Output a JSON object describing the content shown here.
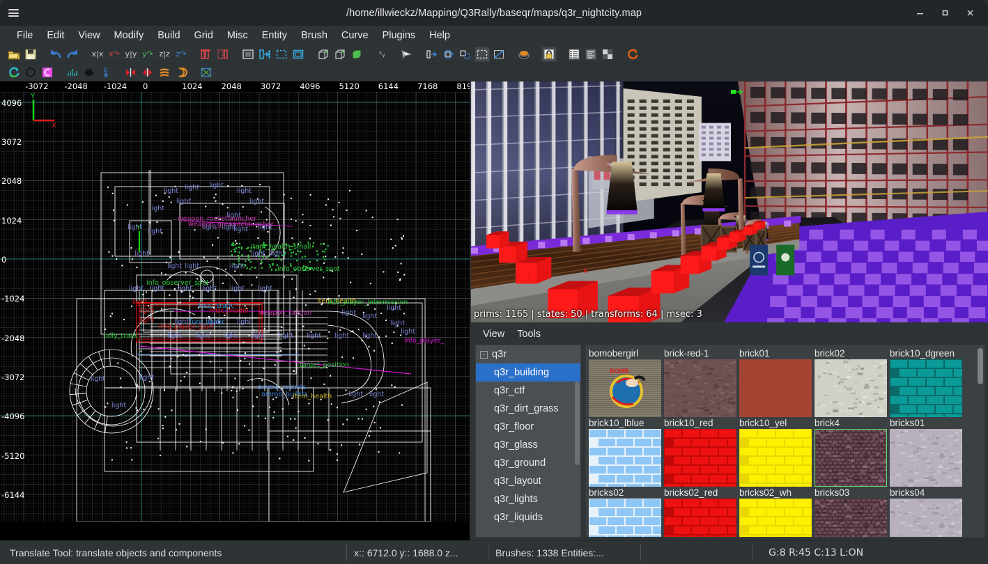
{
  "window": {
    "title": "/home/illwieckz/Mapping/Q3Rally/baseqr/maps/q3r_nightcity.map",
    "menu_icon": "hamburger-icon",
    "minimize_label": "–",
    "maximize_label": "□",
    "close_label": "✕"
  },
  "menubar": {
    "items": [
      {
        "label": "File"
      },
      {
        "label": "Edit"
      },
      {
        "label": "View"
      },
      {
        "label": "Modify"
      },
      {
        "label": "Build"
      },
      {
        "label": "Grid"
      },
      {
        "label": "Misc"
      },
      {
        "label": "Entity"
      },
      {
        "label": "Brush"
      },
      {
        "label": "Curve"
      },
      {
        "label": "Plugins"
      },
      {
        "label": "Help"
      }
    ]
  },
  "toolbar_main": {
    "items": [
      {
        "name": "open-map-icon",
        "kind": "folder",
        "color": "#e8c547"
      },
      {
        "name": "save-map-icon",
        "kind": "floppy",
        "color": "#dcd7a0"
      },
      {
        "name": "undo-icon",
        "kind": "arrow-undo",
        "color": "#3b7fd4"
      },
      {
        "name": "redo-icon",
        "kind": "arrow-redo",
        "color": "#3b7fd4"
      },
      {
        "name": "flip-x-icon",
        "kind": "text",
        "text": "x|x",
        "color": "#cfcfcf"
      },
      {
        "name": "rotate-x-icon",
        "kind": "text",
        "text": "x↷",
        "color": "#d04545"
      },
      {
        "name": "flip-y-icon",
        "kind": "text",
        "text": "y|y",
        "color": "#cfcfcf"
      },
      {
        "name": "rotate-y-icon",
        "kind": "text",
        "text": "y↷",
        "color": "#4fbd4f"
      },
      {
        "name": "flip-z-icon",
        "kind": "text",
        "text": "z|z",
        "color": "#cfcfcf"
      },
      {
        "name": "rotate-z-icon",
        "kind": "text",
        "text": "z↷",
        "color": "#3b7fd4"
      },
      {
        "name": "clipper-icon",
        "kind": "clip",
        "color": "#d64545"
      },
      {
        "name": "connect-entities-icon",
        "kind": "connect",
        "color": "#d64545"
      },
      {
        "name": "complete-tall-icon",
        "kind": "sel-box",
        "color": "#cfcfcf"
      },
      {
        "name": "select-touching-icon",
        "kind": "sel-touch",
        "color": "#37aee2"
      },
      {
        "name": "select-partial-icon",
        "kind": "sel-partial",
        "color": "#37aee2"
      },
      {
        "name": "select-inside-icon",
        "kind": "sel-inside",
        "color": "#37aee2"
      },
      {
        "name": "csg-subtract-icon",
        "kind": "cube",
        "color": "#4fbd4f"
      },
      {
        "name": "csg-merge-icon",
        "kind": "cube",
        "color": "#4fbd4f"
      },
      {
        "name": "csg-hollow-icon",
        "kind": "cube-filled",
        "color": "#4fbd4f"
      },
      {
        "name": "texture-lock-xy-icon",
        "kind": "text",
        "text": "ˣᵧ",
        "color": "#cfcfcf"
      },
      {
        "name": "camera-icon",
        "kind": "cone",
        "color": "#e8e8e8"
      },
      {
        "name": "translate-tool-icon",
        "kind": "translate",
        "color": "#3b7fd4"
      },
      {
        "name": "rotate-tool-icon",
        "kind": "rotate",
        "color": "#3b7fd4"
      },
      {
        "name": "scale-tool-icon",
        "kind": "scale",
        "color": "#3b7fd4"
      },
      {
        "name": "drag-tool-icon",
        "kind": "drag",
        "color": "#cfcfcf",
        "active": true
      },
      {
        "name": "resize-tool-icon",
        "kind": "resize",
        "color": "#3b7fd4"
      },
      {
        "name": "entity-inspector-icon",
        "kind": "ellipse",
        "color": "#e08a2a"
      },
      {
        "name": "texture-lock-icon",
        "kind": "lock",
        "color": "#e8c547",
        "active": true
      },
      {
        "name": "entity-list-icon",
        "kind": "list",
        "color": "#f0f0f0"
      },
      {
        "name": "console-icon",
        "kind": "lines",
        "color": "#9aa0a3"
      },
      {
        "name": "texture-window-icon",
        "kind": "checker",
        "color": "#9aa0a3"
      },
      {
        "name": "refresh-models-icon",
        "kind": "refresh",
        "color": "#e06010"
      }
    ]
  },
  "toolbar_plugins": {
    "items": [
      {
        "name": "bobtoolz-icon",
        "kind": "refresh2",
        "color": "#2bb3c9"
      },
      {
        "name": "prtview-icon",
        "kind": "hexagon",
        "color": "#2a2f31"
      },
      {
        "name": "gtkgensurf-icon",
        "kind": "gensurf",
        "color": "#e84ae8"
      },
      {
        "name": "brush-export-icon",
        "kind": "waves",
        "color": "#2f8f8f"
      },
      {
        "name": "model-icon",
        "kind": "blob",
        "color": "#1a1a1a"
      },
      {
        "name": "entity-export-icon",
        "kind": "eexport",
        "color": "#3b7fd4"
      },
      {
        "name": "mirror-left-icon",
        "kind": "mirror-l",
        "color": "#e02020"
      },
      {
        "name": "mirror-right-icon",
        "kind": "mirror-r",
        "color": "#e02020"
      },
      {
        "name": "bend-icon",
        "kind": "bend",
        "color": "#e08a2a"
      },
      {
        "name": "arc-icon",
        "kind": "arc",
        "color": "#e08a2a"
      },
      {
        "name": "sunplug-icon",
        "kind": "cross-box",
        "color": "#3b7fd4"
      }
    ]
  },
  "xy_view": {
    "x_ticks": [
      "-3072",
      "-2048",
      "-1024",
      "0",
      "1024",
      "2048",
      "3072",
      "4096",
      "5120",
      "6144",
      "7168",
      "819"
    ],
    "y_ticks": [
      "4096",
      "3072",
      "2048",
      "1024",
      "0",
      "-1024",
      "-2048",
      "-3072",
      "-4096",
      "-5120",
      "-6144"
    ],
    "axis_x_label": "X",
    "axis_y_label": "Y",
    "grid_major_color": "#3a3a3a",
    "grid_minor_color": "#202020",
    "axis_color": "#2e8b8b",
    "brush_color": "#ffffff",
    "entity_labels": [
      "light",
      "light",
      "light",
      "light",
      "light",
      "light",
      "light",
      "light",
      "weapon_grenadelauncher",
      "light",
      "light",
      "light",
      "item_health",
      "item_health_small",
      "func_static",
      "func_static",
      "weapon_railgun",
      "info_player_start",
      "info_observer_spot",
      "ammo_rockets",
      "ammo_bullets",
      "ammo_shells",
      "rally_track",
      "target_position",
      "info_player_intermission",
      "misc_model",
      "path_corner"
    ]
  },
  "camera_view": {
    "status": "prims: 1165 | states: 50 | transforms: 64 | msec: 3",
    "prims": 1165,
    "states": 50,
    "transforms": 64,
    "msec": 3
  },
  "texture_browser": {
    "menu": [
      {
        "label": "View"
      },
      {
        "label": "Tools"
      }
    ],
    "tree": {
      "root": {
        "label": "q3r",
        "expanded": true,
        "expander": "-"
      },
      "items": [
        {
          "label": "q3r_building",
          "selected": true
        },
        {
          "label": "q3r_ctf",
          "selected": false
        },
        {
          "label": "q3r_dirt_grass",
          "selected": false
        },
        {
          "label": "q3r_floor",
          "selected": false
        },
        {
          "label": "q3r_glass",
          "selected": false
        },
        {
          "label": "q3r_ground",
          "selected": false
        },
        {
          "label": "q3r_layout",
          "selected": false
        },
        {
          "label": "q3r_lights",
          "selected": false
        },
        {
          "label": "q3r_liquids",
          "selected": false
        }
      ]
    },
    "textures": [
      [
        {
          "label": "bomobergirl",
          "style": "bomobergirl",
          "selected": false
        },
        {
          "label": "brick-red-1",
          "style": "brick-red-1",
          "selected": false
        },
        {
          "label": "brick01",
          "style": "brick01",
          "selected": false
        },
        {
          "label": "brick02",
          "style": "brick02",
          "selected": false
        },
        {
          "label": "brick10_dgreen",
          "style": "teal-brick",
          "selected": false
        }
      ],
      [
        {
          "label": "brick10_lblue",
          "style": "lblue-brick",
          "selected": false
        },
        {
          "label": "brick10_red",
          "style": "red-brick",
          "selected": false
        },
        {
          "label": "brick10_yel",
          "style": "yellow-brick",
          "selected": false
        },
        {
          "label": "brick4",
          "style": "brick4",
          "selected": true
        },
        {
          "label": "bricks01",
          "style": "bricks01",
          "selected": false
        }
      ],
      [
        {
          "label": "bricks02",
          "style": "",
          "selected": false
        },
        {
          "label": "bricks02_red",
          "style": "",
          "selected": false
        },
        {
          "label": "bricks02_wh",
          "style": "",
          "selected": false
        },
        {
          "label": "bricks03",
          "style": "",
          "selected": false
        },
        {
          "label": "bricks04",
          "style": "",
          "selected": false
        }
      ]
    ],
    "selection_outline_color": "#5ee06a"
  },
  "statusbar": {
    "tool_message": "Translate Tool: translate objects and components",
    "position": "x:: 6712.0  y:: 1688.0  z...",
    "counts": "Brushes: 1338 Entities:...",
    "blank": "",
    "flags": "G:8  R:45  C:13  L:ON"
  }
}
